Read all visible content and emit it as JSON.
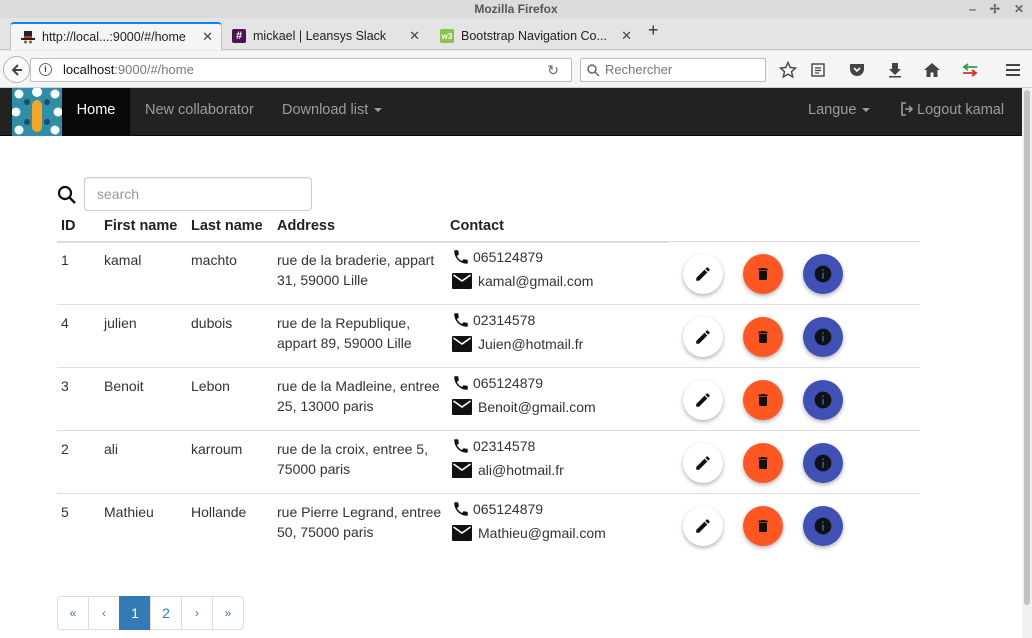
{
  "window": {
    "title": "Mozilla Firefox"
  },
  "tabs": [
    {
      "title": "http://local...:9000/#/home",
      "favicon": "hat-favicon",
      "active": true
    },
    {
      "title": "mickael | Leansys Slack",
      "favicon": "slack-favicon",
      "active": false
    },
    {
      "title": "Bootstrap Navigation Co...",
      "favicon": "w3-favicon",
      "active": false
    }
  ],
  "urlbar": {
    "host": "localhost",
    "path": ":9000/#/home"
  },
  "searchbar": {
    "placeholder": "Rechercher"
  },
  "appnav": {
    "home": "Home",
    "new_collaborator": "New collaborator",
    "download_list": "Download list",
    "langue": "Langue",
    "logout": "Logout kamal"
  },
  "search": {
    "placeholder": "search"
  },
  "table": {
    "headers": {
      "id": "ID",
      "first": "First name",
      "last": "Last name",
      "address": "Address",
      "contact": "Contact"
    },
    "rows": [
      {
        "id": "1",
        "first": "kamal",
        "last": "machto",
        "address": "rue de la braderie, appart 31, 59000 Lille",
        "phone": "065124879",
        "email": "kamal@gmail.com"
      },
      {
        "id": "4",
        "first": "julien",
        "last": "dubois",
        "address": "rue de la Republique, appart 89, 59000 Lille",
        "phone": "02314578",
        "email": "Juien@hotmail.fr"
      },
      {
        "id": "3",
        "first": "Benoit",
        "last": "Lebon",
        "address": "rue de la Madleine, entree 25, 13000 paris",
        "phone": "065124879",
        "email": "Benoit@gmail.com"
      },
      {
        "id": "2",
        "first": "ali",
        "last": "karroum",
        "address": "rue de la croix, entree 5, 75000 paris",
        "phone": "02314578",
        "email": "ali@hotmail.fr"
      },
      {
        "id": "5",
        "first": "Mathieu",
        "last": "Hollande",
        "address": "rue Pierre Legrand, entree 50, 75000 paris",
        "phone": "065124879",
        "email": "Mathieu@gmail.com"
      }
    ]
  },
  "pagination": {
    "first": "«",
    "prev": "‹",
    "pages": [
      "1",
      "2"
    ],
    "current": "1",
    "next": "›",
    "last": "»"
  },
  "colors": {
    "navbar": "#222222",
    "edit": "#ffffff",
    "delete": "#ff5722",
    "info": "#3f51b5",
    "link": "#337ab7"
  }
}
